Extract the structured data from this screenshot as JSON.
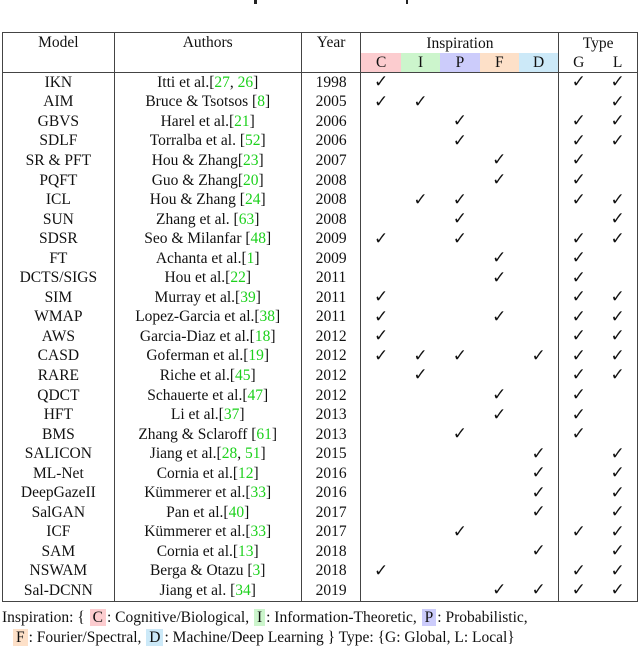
{
  "table": {
    "headers": {
      "model": "Model",
      "authors": "Authors",
      "year": "Year",
      "inspiration": "Inspiration",
      "type": "Type"
    },
    "inspiration_columns": [
      {
        "key": "C",
        "label": "C",
        "color": "#fccccf"
      },
      {
        "key": "I",
        "label": "I",
        "color": "#ccf5cc"
      },
      {
        "key": "P",
        "label": "P",
        "color": "#ccccfb"
      },
      {
        "key": "F",
        "label": "F",
        "color": "#fde0c8"
      },
      {
        "key": "D",
        "label": "D",
        "color": "#cce9f8"
      }
    ],
    "type_columns": [
      {
        "key": "G",
        "label": "G"
      },
      {
        "key": "L",
        "label": "L"
      }
    ],
    "check_glyph": "✓",
    "ref_color": "#1cd11c",
    "rows": [
      {
        "model": "IKN",
        "authors": "Itti et al.",
        "refs": "[27, 26]",
        "refs_parts": [
          "[",
          "27",
          ", ",
          "26",
          "]"
        ],
        "year": "1998",
        "C": true,
        "I": false,
        "P": false,
        "F": false,
        "D": false,
        "G": true,
        "L": true
      },
      {
        "model": "AIM",
        "authors": "Bruce & Tsotsos ",
        "refs_parts": [
          "[",
          "8",
          "]"
        ],
        "year": "2005",
        "C": true,
        "I": true,
        "P": false,
        "F": false,
        "D": false,
        "G": false,
        "L": true
      },
      {
        "model": "GBVS",
        "authors": "Harel et al.",
        "refs_parts": [
          "[",
          "21",
          "]"
        ],
        "year": "2006",
        "C": false,
        "I": false,
        "P": true,
        "F": false,
        "D": false,
        "G": true,
        "L": true
      },
      {
        "model": "SDLF",
        "authors": "Torralba et al. ",
        "refs_parts": [
          "[",
          "52",
          "]"
        ],
        "year": "2006",
        "C": false,
        "I": false,
        "P": true,
        "F": false,
        "D": false,
        "G": true,
        "L": true
      },
      {
        "model": "SR & PFT",
        "authors": "Hou & Zhang",
        "refs_parts": [
          "[",
          "23",
          "]"
        ],
        "year": "2007",
        "C": false,
        "I": false,
        "P": false,
        "F": true,
        "D": false,
        "G": true,
        "L": false
      },
      {
        "model": "PQFT",
        "authors": "Guo & Zhang",
        "refs_parts": [
          "[",
          "20",
          "]"
        ],
        "year": "2008",
        "C": false,
        "I": false,
        "P": false,
        "F": true,
        "D": false,
        "G": true,
        "L": false
      },
      {
        "model": "ICL",
        "authors": "Hou & Zhang ",
        "refs_parts": [
          "[",
          "24",
          "]"
        ],
        "year": "2008",
        "C": false,
        "I": true,
        "P": true,
        "F": false,
        "D": false,
        "G": true,
        "L": true
      },
      {
        "model": "SUN",
        "authors": "Zhang et al. ",
        "refs_parts": [
          "[",
          "63",
          "]"
        ],
        "year": "2008",
        "C": false,
        "I": false,
        "P": true,
        "F": false,
        "D": false,
        "G": false,
        "L": true
      },
      {
        "model": "SDSR",
        "authors": "Seo & Milanfar ",
        "refs_parts": [
          "[",
          "48",
          "]"
        ],
        "year": "2009",
        "C": true,
        "I": false,
        "P": true,
        "F": false,
        "D": false,
        "G": true,
        "L": true
      },
      {
        "model": "FT",
        "authors": "Achanta et al.",
        "refs_parts": [
          "[",
          "1",
          "]"
        ],
        "year": "2009",
        "C": false,
        "I": false,
        "P": false,
        "F": true,
        "D": false,
        "G": true,
        "L": false
      },
      {
        "model": "DCTS/SIGS",
        "authors": "Hou et al.",
        "refs_parts": [
          "[",
          "22",
          "]"
        ],
        "year": "2011",
        "C": false,
        "I": false,
        "P": false,
        "F": true,
        "D": false,
        "G": true,
        "L": false
      },
      {
        "model": "SIM",
        "authors": "Murray et al.",
        "refs_parts": [
          "[",
          "39",
          "]"
        ],
        "year": "2011",
        "C": true,
        "I": false,
        "P": false,
        "F": false,
        "D": false,
        "G": true,
        "L": true
      },
      {
        "model": "WMAP",
        "authors": "Lopez-Garcia et al.",
        "refs_parts": [
          "[",
          "38",
          "]"
        ],
        "year": "2011",
        "C": true,
        "I": false,
        "P": false,
        "F": true,
        "D": false,
        "G": true,
        "L": true
      },
      {
        "model": "AWS",
        "authors": "Garcia-Diaz et al.",
        "refs_parts": [
          "[",
          "18",
          "]"
        ],
        "year": "2012",
        "C": true,
        "I": false,
        "P": false,
        "F": false,
        "D": false,
        "G": true,
        "L": true
      },
      {
        "model": "CASD",
        "authors": "Goferman et al.",
        "refs_parts": [
          "[",
          "19",
          "]"
        ],
        "year": "2012",
        "C": true,
        "I": true,
        "P": true,
        "F": false,
        "D": true,
        "G": true,
        "L": true
      },
      {
        "model": "RARE",
        "authors": "Riche et al.",
        "refs_parts": [
          "[",
          "45",
          "]"
        ],
        "year": "2012",
        "C": false,
        "I": true,
        "P": false,
        "F": false,
        "D": false,
        "G": true,
        "L": true
      },
      {
        "model": "QDCT",
        "authors": "Schauerte et al.",
        "refs_parts": [
          "[",
          "47",
          "]"
        ],
        "year": "2012",
        "C": false,
        "I": false,
        "P": false,
        "F": true,
        "D": false,
        "G": true,
        "L": false
      },
      {
        "model": "HFT",
        "authors": "Li et al.",
        "refs_parts": [
          "[",
          "37",
          "]"
        ],
        "year": "2013",
        "C": false,
        "I": false,
        "P": false,
        "F": true,
        "D": false,
        "G": true,
        "L": false
      },
      {
        "model": "BMS",
        "authors": "Zhang & Sclaroff ",
        "refs_parts": [
          "[",
          "61",
          "]"
        ],
        "year": "2013",
        "C": false,
        "I": false,
        "P": true,
        "F": false,
        "D": false,
        "G": true,
        "L": false
      },
      {
        "model": "SALICON",
        "authors": "Jiang et al.",
        "refs_parts": [
          "[",
          "28",
          ", ",
          "51",
          "]"
        ],
        "year": "2015",
        "C": false,
        "I": false,
        "P": false,
        "F": false,
        "D": true,
        "G": false,
        "L": true
      },
      {
        "model": "ML-Net",
        "authors": "Cornia et al.",
        "refs_parts": [
          "[",
          "12",
          "]"
        ],
        "year": "2016",
        "C": false,
        "I": false,
        "P": false,
        "F": false,
        "D": true,
        "G": false,
        "L": true
      },
      {
        "model": "DeepGazeII",
        "authors": "Kümmerer et al.",
        "refs_parts": [
          "[",
          "33",
          "]"
        ],
        "year": "2016",
        "C": false,
        "I": false,
        "P": false,
        "F": false,
        "D": true,
        "G": false,
        "L": true
      },
      {
        "model": "SalGAN",
        "authors": "Pan et al.",
        "refs_parts": [
          "[",
          "40",
          "]"
        ],
        "year": "2017",
        "C": false,
        "I": false,
        "P": false,
        "F": false,
        "D": true,
        "G": false,
        "L": true
      },
      {
        "model": "ICF",
        "authors": "Kümmerer et al.",
        "refs_parts": [
          "[",
          "33",
          "]"
        ],
        "year": "2017",
        "C": false,
        "I": false,
        "P": true,
        "F": false,
        "D": false,
        "G": true,
        "L": true
      },
      {
        "model": "SAM",
        "authors": "Cornia et al.",
        "refs_parts": [
          "[",
          "13",
          "]"
        ],
        "year": "2018",
        "C": false,
        "I": false,
        "P": false,
        "F": false,
        "D": true,
        "G": false,
        "L": true
      },
      {
        "model": "NSWAM",
        "authors": "Berga & Otazu ",
        "refs_parts": [
          "[",
          "3",
          "]"
        ],
        "year": "2018",
        "C": true,
        "I": false,
        "P": false,
        "F": false,
        "D": false,
        "G": true,
        "L": true
      },
      {
        "model": "Sal-DCNN",
        "authors": "Jiang et al. ",
        "refs_parts": [
          "[",
          "34",
          "]"
        ],
        "year": "2019",
        "C": false,
        "I": false,
        "P": false,
        "F": true,
        "D": true,
        "G": true,
        "L": true
      }
    ]
  },
  "legend": {
    "inspiration_prefix": "Inspiration: {",
    "items": [
      {
        "key": "C",
        "text": ": Cognitive/Biological,"
      },
      {
        "key": "I",
        "text": ": Information-Theoretic,"
      },
      {
        "key": "P",
        "text": ": Probabilistic,"
      },
      {
        "key": "F",
        "text": ": Fourier/Spectral,"
      },
      {
        "key": "D",
        "text": ": Machine/Deep Learning"
      }
    ],
    "inspiration_suffix": "}",
    "type_text": " Type: {G: Global, L: Local}"
  }
}
